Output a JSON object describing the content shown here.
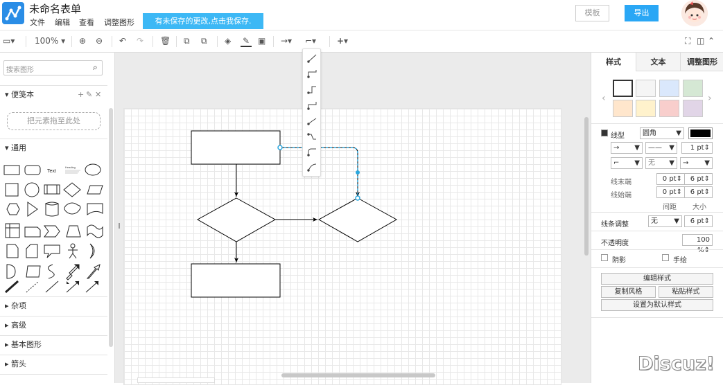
{
  "header": {
    "title": "未命名表单",
    "menus": [
      "文件",
      "编辑",
      "查看",
      "调整图形"
    ],
    "unsaved_notice": "有未保存的更改,点击我保存.",
    "template_label": "模板",
    "export_label": "导出"
  },
  "toolbar": {
    "zoom": "100%"
  },
  "sidebar": {
    "search_placeholder": "搜索图形",
    "sections": {
      "scratchpad": "便笺本",
      "general": "通用",
      "misc": "杂项",
      "advanced": "高级",
      "basic": "基本图形",
      "arrows": "箭头"
    },
    "dropzone": "把元素拖至此处",
    "shape_text": "Text",
    "shape_heading": "Heading"
  },
  "panel": {
    "tabs": [
      "样式",
      "文本",
      "调整图形"
    ],
    "line_label": "线型",
    "line_style": "圆角",
    "line_width": "1 pt",
    "none_label": "无",
    "end_label": "线末端",
    "start_label": "线始端",
    "end_spacing": "0 pt",
    "end_size": "6 pt",
    "start_spacing": "0 pt",
    "start_size": "6 pt",
    "spacing_label": "间距",
    "size_label": "大小",
    "jump_label": "线条调整",
    "jump_style": "无",
    "jump_size": "6 pt",
    "opacity_label": "不透明度",
    "opacity_value": "100 %",
    "shadow_label": "阴影",
    "sketch_label": "手绘",
    "edit_style": "编辑样式",
    "copy_style": "复制风格",
    "paste_style": "粘贴样式",
    "set_default": "设置为默认样式",
    "colors": {
      "swatches": [
        "#ffffff",
        "#f5f5f5",
        "#dae8fc",
        "#d5e8d4",
        "#ffe6cc",
        "#fff2cc",
        "#f8cecc",
        "#e1d5e7"
      ],
      "line_color": "#000000",
      "selection": "#29a8e0"
    }
  },
  "watermark": "Discuz!"
}
